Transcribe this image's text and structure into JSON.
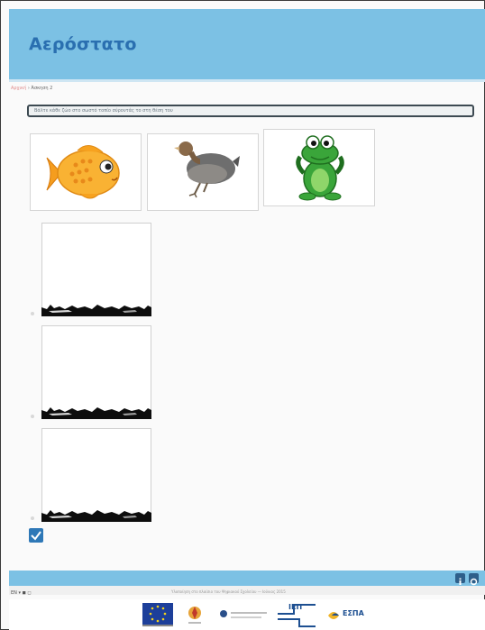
{
  "header": {
    "title": "Αερόστατο"
  },
  "breadcrumb": {
    "home": "Αρχική",
    "separator": "›",
    "current": "Άσκηση 2"
  },
  "instruction": {
    "text": "Βάλτε κάθε ζώο στο σωστό τοπίο σύροντάς το στη θέση του"
  },
  "cards": [
    {
      "animal": "fish",
      "icon": "fish-icon"
    },
    {
      "animal": "bird",
      "icon": "bird-icon"
    },
    {
      "animal": "frog",
      "icon": "frog-icon"
    }
  ],
  "dropzones": 3,
  "check_button": {
    "icon": "check-icon"
  },
  "footer": {
    "left_text": "EN ▾  ◼ ◻",
    "center_text": "Υλοποίηση στο πλαίσιο του Ψηφιακού Σχολείου — Ιούνιος 2015",
    "logos": [
      "eu-flag-logo",
      "institute-logo",
      "ministry-logo",
      "iep-logo",
      "espa-logo"
    ],
    "iep_label": "ΙΕΠ",
    "espa_label": "ΕΣΠΑ"
  },
  "colors": {
    "header": "#7cc1e4",
    "title": "#2a6fb0",
    "button": "#2e78b7"
  }
}
